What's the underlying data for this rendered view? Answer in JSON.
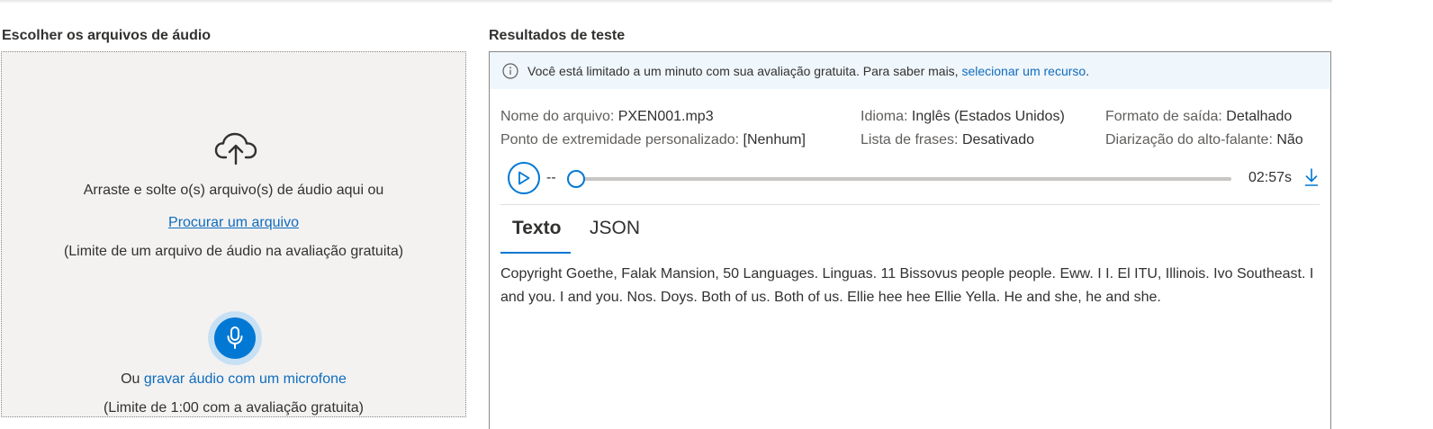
{
  "left": {
    "title": "Escolher os arquivos de áudio",
    "drag_text": "Arraste e solte o(s) arquivo(s) de áudio aqui ou",
    "browse_link": "Procurar um arquivo",
    "file_limit": "(Limite de um arquivo de áudio na avaliação gratuita)",
    "record_prefix": "Ou ",
    "record_link": "gravar áudio com um microfone",
    "record_limit": "(Limite de 1:00 com a avaliação gratuita)",
    "icons": [
      "cloud-upload-icon",
      "microphone-icon"
    ]
  },
  "right": {
    "title": "Resultados de teste",
    "info": {
      "text": "Você está limitado a um minuto com sua avaliação gratuita. Para saber mais, ",
      "link": "selecionar um recurso",
      "suffix": "."
    },
    "meta": {
      "file_label": "Nome do arquivo:",
      "file_value": "PXEN001.mp3",
      "endpoint_label": "Ponto de extremidade personalizado:",
      "endpoint_value": "[Nenhum]",
      "language_label": "Idioma:",
      "language_value": "Inglês (Estados Unidos)",
      "phrases_label": "Lista de frases:",
      "phrases_value": "Desativado",
      "format_label": "Formato de saída:",
      "format_value": "Detalhado",
      "diarization_label": "Diarização do alto-falante:",
      "diarization_value": "Não"
    },
    "player": {
      "current_time": "--",
      "total_time": "02:57s",
      "progress": 0
    },
    "tabs": [
      {
        "label": "Texto",
        "active": true
      },
      {
        "label": "JSON",
        "active": false
      }
    ],
    "transcript": "Copyright Goethe, Falak Mansion, 50 Languages. Linguas. 11 Bissovus people people. Eww. I I. El ITU, Illinois. Ivo Southeast. I and you. I and you. Nos. Doys. Both of us. Both of us. Ellie hee hee Ellie Yella. He and she, he and she."
  },
  "colors": {
    "accent": "#0078d4",
    "link": "#0f6cbd",
    "dropzone_bg": "#f3f2f1",
    "info_bg": "#eff6fc"
  }
}
